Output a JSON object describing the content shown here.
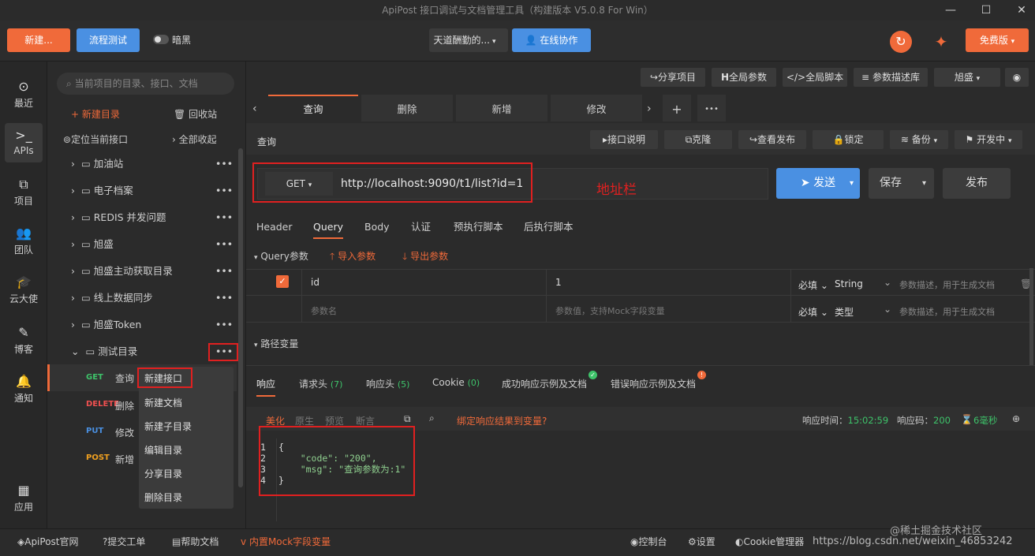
{
  "window": {
    "title": "ApiPost 接口调试与文档管理工具（构建版本 V5.0.8 For Win）",
    "min": "—",
    "max": "☐",
    "close": "✕"
  },
  "toolbar": {
    "new_label": "新建...",
    "flow_label": "流程测试",
    "dark_label": "暗黑",
    "workspace": "天道酬勤的...",
    "collab": "在线协作",
    "free": "免费版"
  },
  "rail": [
    {
      "label": "最近",
      "icon": "⊙"
    },
    {
      "label": "APIs",
      "icon": ">_"
    },
    {
      "label": "项目",
      "icon": "⧉"
    },
    {
      "label": "团队",
      "icon": "👥"
    },
    {
      "label": "云大使",
      "icon": "🎓"
    },
    {
      "label": "博客",
      "icon": "✎"
    },
    {
      "label": "通知",
      "icon": "🔔"
    },
    {
      "label": "应用",
      "icon": "▦"
    }
  ],
  "sidebar": {
    "search_placeholder": "当前项目的目录、接口、文档",
    "new_dir": "新建目录",
    "recycle": "回收站",
    "locate": "定位当前接口",
    "collapse": "全部收起",
    "folders": [
      "加油站",
      "电子档案",
      "REDIS 并发问题",
      "旭盛",
      "旭盛主动获取目录",
      "线上数据同步",
      "旭盛Token",
      "测试目录"
    ],
    "apis": [
      {
        "method": "GET",
        "name": "查询",
        "color": "#3ec36a"
      },
      {
        "method": "DELETE",
        "name": "删除",
        "color": "#f05050"
      },
      {
        "method": "PUT",
        "name": "修改",
        "color": "#4a90e2"
      },
      {
        "method": "POST",
        "name": "新增",
        "color": "#f0a020"
      }
    ],
    "more": "•••"
  },
  "context_menu": [
    "新建接口",
    "新建文档",
    "新建子目录",
    "编辑目录",
    "分享目录",
    "删除目录"
  ],
  "topright": {
    "share": "分享项目",
    "global_params": "全局参数",
    "global_script": "全局脚本",
    "param_lib": "参数描述库",
    "user": "旭盛"
  },
  "tabs": [
    "查询",
    "删除",
    "新增",
    "修改"
  ],
  "tab_plus": "+",
  "tab_more": "•••",
  "request": {
    "name": "查询",
    "doc": "接口说明",
    "clone": "克隆",
    "publish_view": "查看发布",
    "lock": "锁定",
    "backup": "备份",
    "status": "开发中",
    "method": "GET",
    "url": "http://localhost:9090/t1/list?id=1",
    "annotation": "地址栏",
    "send": "发送",
    "save": "保存",
    "publish": "发布"
  },
  "subtabs": [
    "Header",
    "Query",
    "Body",
    "认证",
    "预执行脚本",
    "后执行脚本"
  ],
  "query": {
    "title": "Query参数",
    "import": "导入参数",
    "export": "导出参数",
    "row1": {
      "key": "id",
      "value": "1",
      "required": "必填",
      "type": "String",
      "desc": "参数描述，用于生成文档"
    },
    "row2": {
      "key": "参数名",
      "value": "参数值，支持Mock字段变量",
      "required": "必填",
      "type": "类型",
      "desc": "参数描述，用于生成文档"
    },
    "path_vars": "路径变量"
  },
  "response": {
    "tabs": [
      {
        "label": "响应",
        "count": ""
      },
      {
        "label": "请求头",
        "count": "(7)"
      },
      {
        "label": "响应头",
        "count": "(5)"
      },
      {
        "label": "Cookie",
        "count": "(0)"
      },
      {
        "label": "成功响应示例及文档",
        "count": ""
      },
      {
        "label": "错误响应示例及文档",
        "count": ""
      }
    ],
    "views": [
      "美化",
      "原生",
      "预览",
      "断言"
    ],
    "bind": "绑定响应结果到变量?",
    "time_label": "响应时间：",
    "time": "15:02:59",
    "code_label": "响应码：",
    "code": "200",
    "duration": "6毫秒",
    "lines": [
      "{",
      "    \"code\": \"200\",",
      "    \"msg\": \"查询参数为:1\"",
      "}"
    ]
  },
  "status": {
    "site": "ApiPost官网",
    "ticket": "提交工单",
    "help": "帮助文档",
    "mock": "内置Mock字段变量",
    "console": "控制台",
    "settings": "设置",
    "cookie": "Cookie管理器",
    "watermark": "https://blog.csdn.net/weixin_46853242",
    "watermark2": "@稀土掘金技术社区"
  }
}
